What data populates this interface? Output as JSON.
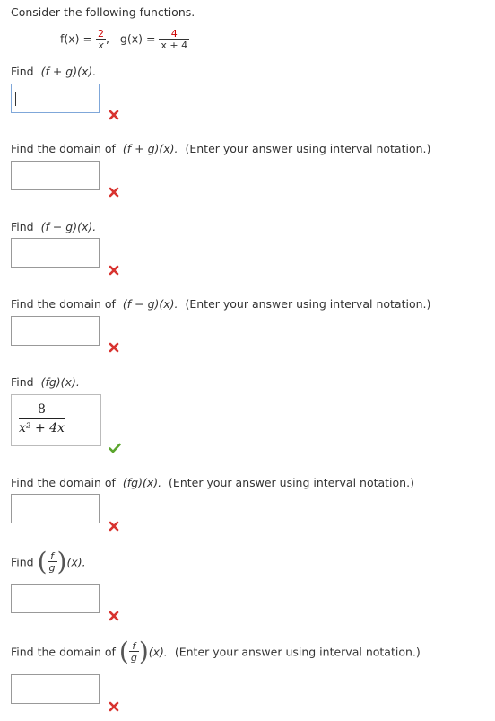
{
  "intro": "Consider the following functions.",
  "functions": {
    "f_label": "f(x) =",
    "f_num": "2",
    "f_den": "x",
    "sep": ",",
    "g_label": "g(x) =",
    "g_num": "4",
    "g_den": "x + 4"
  },
  "questions": {
    "q1": {
      "prefix": "Find",
      "expr": "(f + g)(x)."
    },
    "q2": {
      "prefix": "Find the domain of",
      "expr": "(f + g)(x).",
      "suffix": "(Enter your answer using interval notation.)"
    },
    "q3": {
      "prefix": "Find",
      "expr": "(f − g)(x)."
    },
    "q4": {
      "prefix": "Find the domain of",
      "expr": "(f − g)(x).",
      "suffix": "(Enter your answer using interval notation.)"
    },
    "q5": {
      "prefix": "Find",
      "expr": "(fg)(x)."
    },
    "q6": {
      "prefix": "Find the domain of",
      "expr": "(fg)(x).",
      "suffix": "(Enter your answer using interval notation.)"
    },
    "q7": {
      "prefix": "Find",
      "frac_num": "f",
      "frac_den": "g",
      "expr": "(x)."
    },
    "q8": {
      "prefix": "Find the domain of",
      "frac_num": "f",
      "frac_den": "g",
      "expr": "(x).",
      "suffix": "(Enter your answer using interval notation.)"
    }
  },
  "answers": {
    "a1": "",
    "a2": "",
    "a3": "",
    "a4": "",
    "a5_num": "8",
    "a5_den": "x² + 4x",
    "a6": "",
    "a7": "",
    "a8": ""
  },
  "status": {
    "a1": "incorrect",
    "a2": "incorrect",
    "a3": "incorrect",
    "a4": "incorrect",
    "a5": "correct",
    "a6": "incorrect",
    "a7": "incorrect",
    "a8": "incorrect"
  },
  "colors": {
    "incorrect": "#d8332f",
    "correct": "#5aa52c",
    "accent_red": "#cc0000"
  }
}
